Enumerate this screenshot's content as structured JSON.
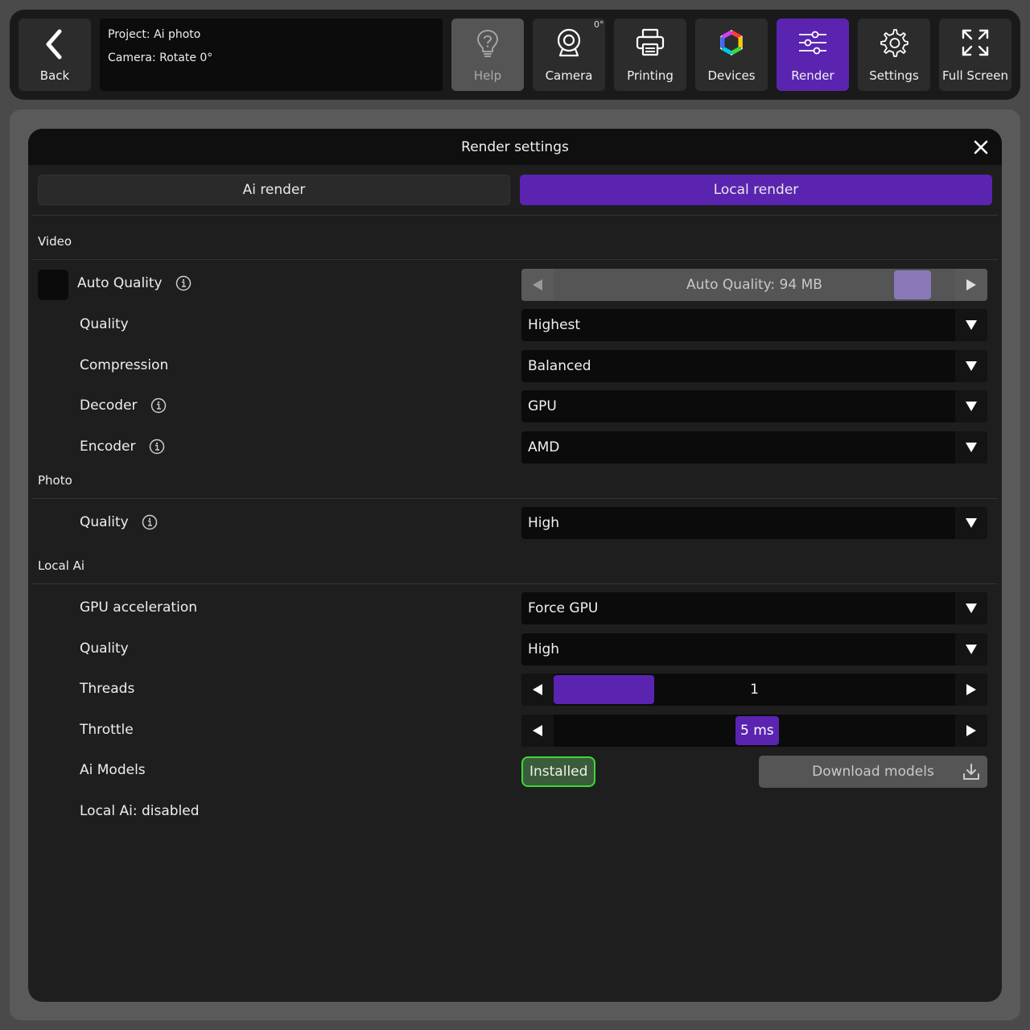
{
  "toolbar": {
    "back_label": "Back",
    "project_text": "Project: Ai photo",
    "camera_text": "Camera: Rotate 0°",
    "camera_rotation_badge": "0°",
    "buttons": [
      {
        "label": "Help",
        "icon": "help-icon",
        "state": "disabled"
      },
      {
        "label": "Camera",
        "icon": "webcam-icon",
        "state": "normal"
      },
      {
        "label": "Printing",
        "icon": "printer-icon",
        "state": "normal"
      },
      {
        "label": "Devices",
        "icon": "devices-icon",
        "state": "normal"
      },
      {
        "label": "Render",
        "icon": "sliders-icon",
        "state": "active"
      },
      {
        "label": "Settings",
        "icon": "gear-icon",
        "state": "normal"
      },
      {
        "label": "Full Screen",
        "icon": "fullscreen-icon",
        "state": "normal"
      }
    ]
  },
  "modal": {
    "title": "Render settings",
    "tabs": {
      "ai_render": "Ai render",
      "local_render": "Local render",
      "active": "local_render"
    },
    "video": {
      "section_title": "Video",
      "auto_quality_label": "Auto Quality",
      "auto_quality_checked": false,
      "auto_quality_slider_text": "Auto Quality: 94 MB",
      "quality_label": "Quality",
      "quality_value": "Highest",
      "compression_label": "Compression",
      "compression_value": "Balanced",
      "decoder_label": "Decoder",
      "decoder_value": "GPU",
      "encoder_label": "Encoder",
      "encoder_value": "AMD"
    },
    "photo": {
      "section_title": "Photo",
      "quality_label": "Quality",
      "quality_value": "High"
    },
    "local_ai": {
      "section_title": "Local Ai",
      "gpu_label": "GPU acceleration",
      "gpu_value": "Force GPU",
      "quality_label": "Quality",
      "quality_value": "High",
      "threads_label": "Threads",
      "threads_value": "1",
      "throttle_label": "Throttle",
      "throttle_value": "5 ms",
      "models_label": "Ai Models",
      "models_status": "Installed",
      "download_label": "Download models",
      "status_text": "Local Ai: disabled"
    }
  },
  "colors": {
    "accent": "#5a24b0",
    "installed_border": "#3cd83c",
    "background": "#1e1e1e"
  }
}
